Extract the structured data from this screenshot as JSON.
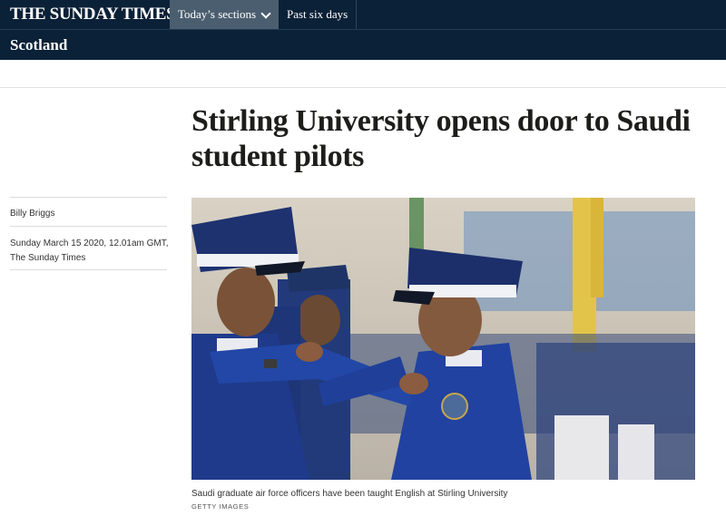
{
  "header": {
    "masthead": "THE SUNDAY TIMES",
    "nav": {
      "todays_sections": "Today’s sections",
      "past_six_days": "Past six days"
    },
    "section": "Scotland"
  },
  "article": {
    "headline": "Stirling University opens door to Saudi student pilots",
    "author": "Billy Briggs",
    "dateline": "Sunday March 15 2020, 12.01am GMT, The Sunday Times",
    "image": {
      "caption": "Saudi graduate air force officers have been taught English at Stirling University",
      "credit": "GETTY IMAGES"
    }
  },
  "colors": {
    "masthead_bg": "#0b2137",
    "active_nav_bg": "#4b5e70",
    "uniform_blue": "#1f3a8a",
    "cap_white": "#eef0f4"
  },
  "icons": {
    "dropdown": "chevron-down-icon"
  }
}
